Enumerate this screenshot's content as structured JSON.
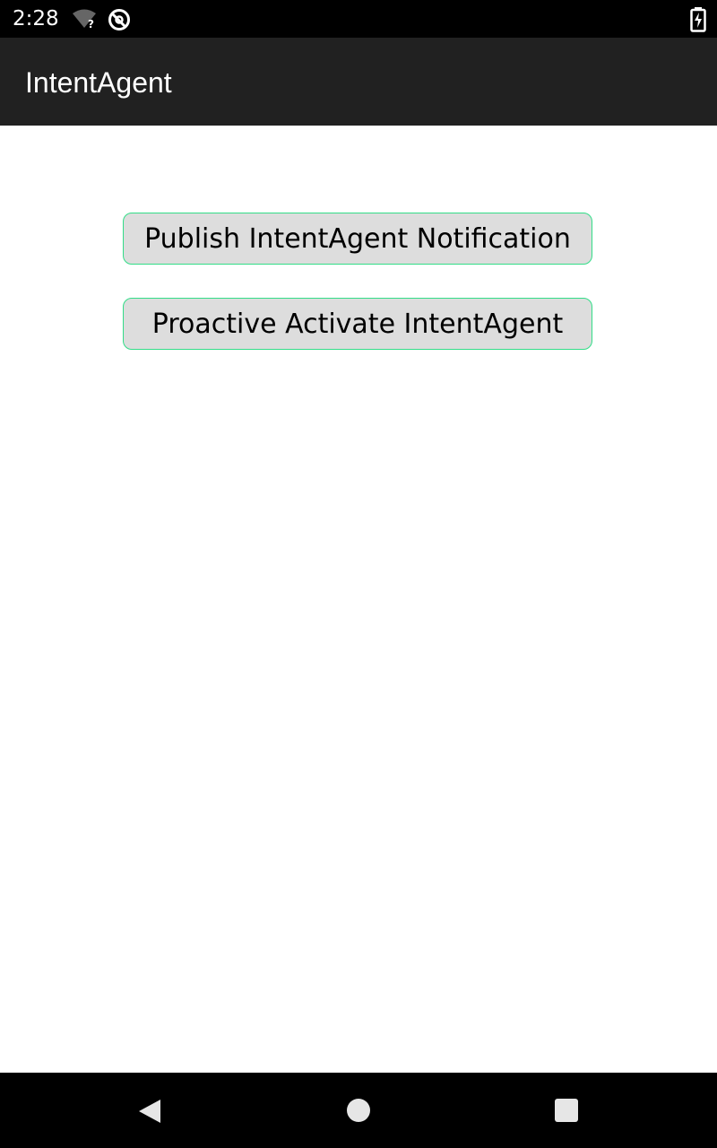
{
  "status_bar": {
    "time": "2:28",
    "icons": [
      "wifi-unknown-icon",
      "do-not-disturb-icon",
      "battery-charging-icon"
    ]
  },
  "app_bar": {
    "title": "IntentAgent"
  },
  "main": {
    "buttons": [
      {
        "label": "Publish IntentAgent Notification"
      },
      {
        "label": "Proactive Activate IntentAgent"
      }
    ]
  },
  "nav_bar": {
    "icons": [
      "back-icon",
      "home-icon",
      "recents-icon"
    ]
  },
  "colors": {
    "status_bar_bg": "#000000",
    "app_bar_bg": "#212121",
    "button_bg": "#dddddd",
    "button_border": "#33dd88",
    "nav_bar_bg": "#000000"
  }
}
